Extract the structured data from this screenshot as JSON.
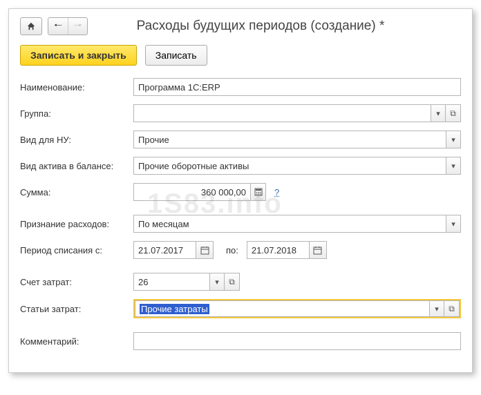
{
  "title": "Расходы будущих периодов (создание) *",
  "toolbar": {
    "save_close": "Записать и закрыть",
    "save": "Записать"
  },
  "labels": {
    "name": "Наименование:",
    "group": "Группа:",
    "tax_kind": "Вид для НУ:",
    "asset_kind": "Вид актива в балансе:",
    "amount": "Сумма:",
    "recognition": "Признание расходов:",
    "period_from": "Период списания с:",
    "period_to": "по:",
    "expense_account": "Счет затрат:",
    "expense_item": "Статьи затрат:",
    "comment": "Комментарий:"
  },
  "values": {
    "name": "Программа 1С:ERP",
    "group": "",
    "tax_kind": "Прочие",
    "asset_kind": "Прочие оборотные активы",
    "amount": "360 000,00",
    "recognition": "По месяцам",
    "period_from": "21.07.2017",
    "period_to": "21.07.2018",
    "expense_account": "26",
    "expense_item": "Прочие затраты",
    "comment": ""
  },
  "help": "?",
  "watermark": "1S83.info"
}
